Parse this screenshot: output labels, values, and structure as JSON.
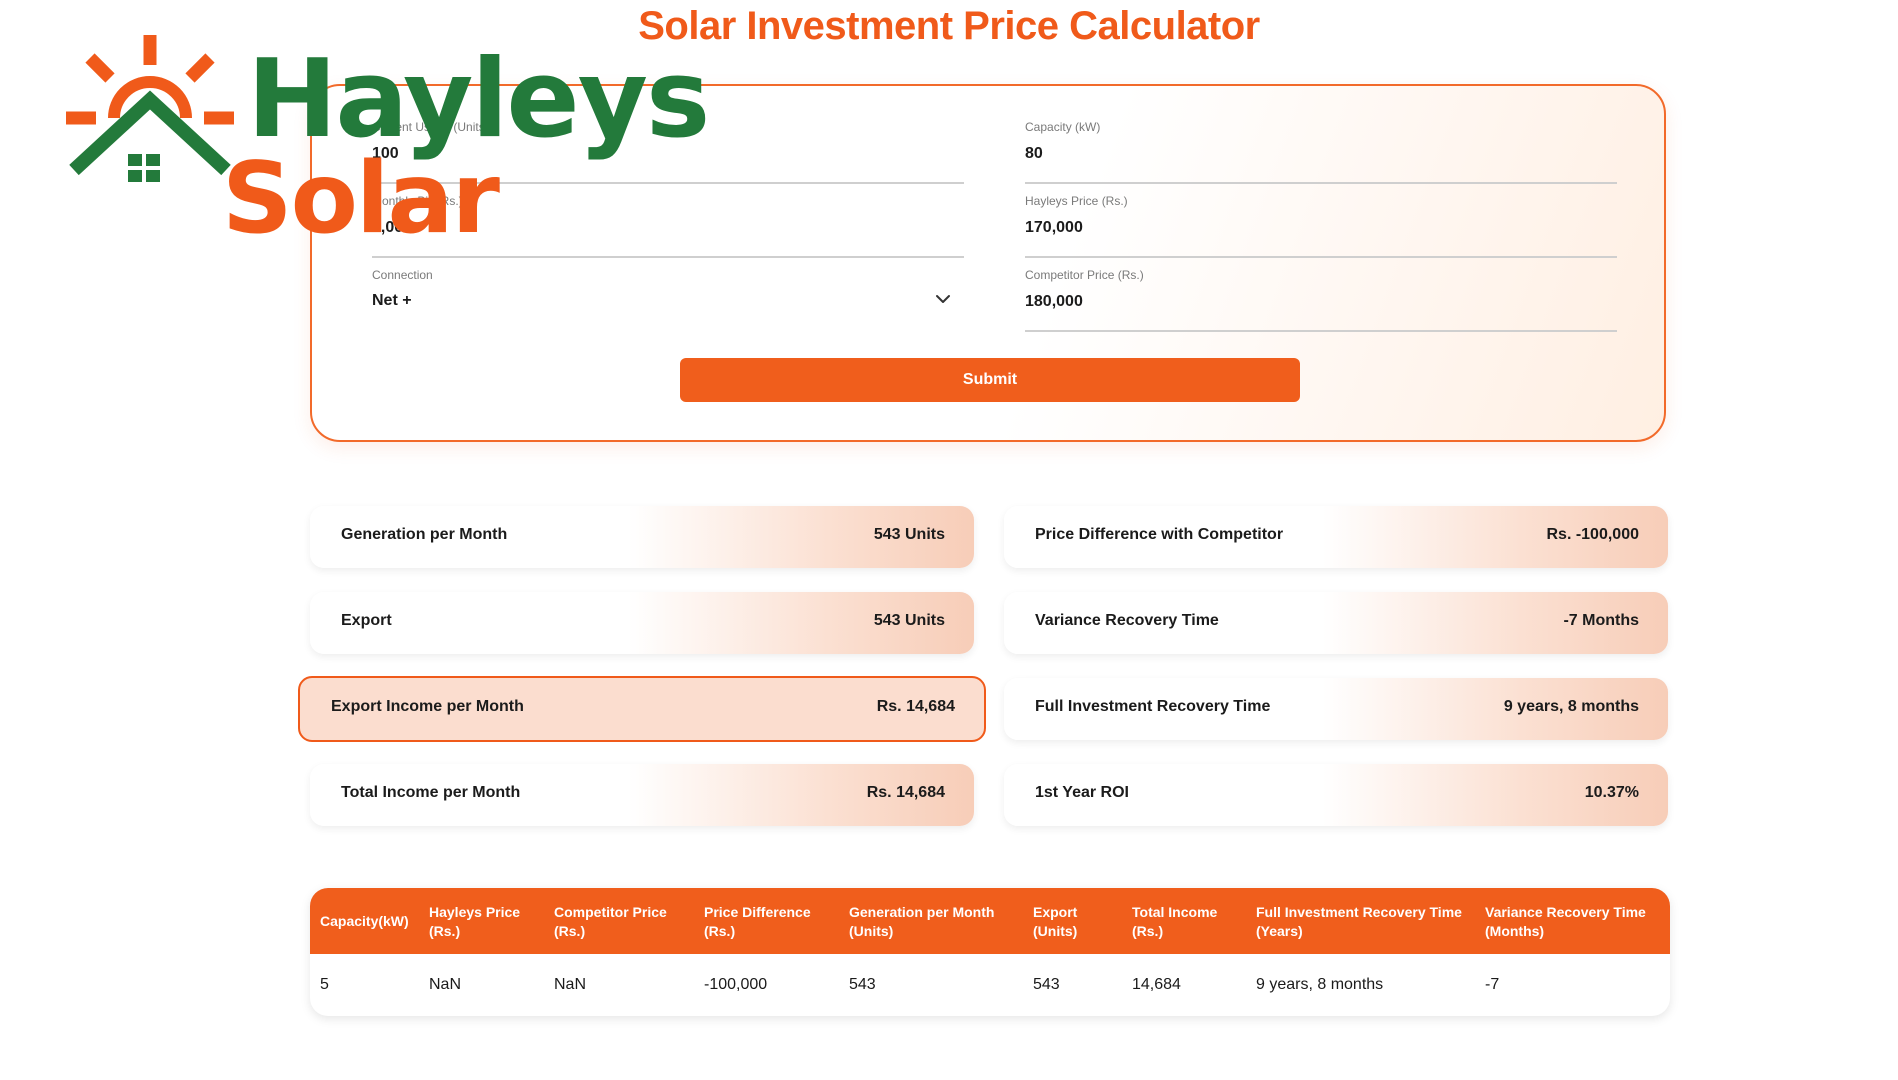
{
  "logo": {
    "top_word": "Hayleys",
    "bottom_word": "Solar"
  },
  "title": "Solar Investment Price Calculator",
  "form": {
    "fields": [
      {
        "label": "Current Usage (Units)",
        "value": "100"
      },
      {
        "label": "Monthly Bill (Rs.)",
        "value": "8,000"
      },
      {
        "label": "Capacity (kW)",
        "value": "80"
      },
      {
        "label": "Hayleys Price (Rs.)",
        "value": "170,000"
      },
      {
        "label": "Competitor Price (Rs.)",
        "value": "180,000"
      }
    ],
    "connection": {
      "label": "Connection",
      "value": "Net +"
    },
    "submit_label": "Submit"
  },
  "results": [
    {
      "label": "Generation per Month",
      "value": "543 Units"
    },
    {
      "label": "Export",
      "value": "543 Units"
    },
    {
      "label": "Export Income per Month",
      "value": "Rs. 14,684"
    },
    {
      "label": "Total Income per Month",
      "value": "Rs. 14,684"
    },
    {
      "label": "Price Difference with Competitor",
      "value": "Rs. -100,000"
    },
    {
      "label": "Variance Recovery Time",
      "value": "-7 Months"
    },
    {
      "label": "Full Investment Recovery Time",
      "value": "9 years, 8 months"
    },
    {
      "label": "1st Year ROI",
      "value": "10.37%"
    }
  ],
  "table": {
    "headers": [
      [
        "Capacity(kW)"
      ],
      [
        "Hayleys Price",
        "(Rs.)"
      ],
      [
        "Competitor Price",
        "(Rs.)"
      ],
      [
        "Price Difference",
        "(Rs.)"
      ],
      [
        "Generation per Month",
        "(Units)"
      ],
      [
        "Export",
        "(Units)"
      ],
      [
        "Total Income",
        "(Rs.)"
      ],
      [
        "Full Investment Recovery Time",
        "(Years)"
      ],
      [
        "Variance Recovery Time",
        "(Months)"
      ]
    ],
    "row": [
      "5",
      "NaN",
      "NaN",
      "-100,000",
      "543",
      "543",
      "14,684",
      "9 years, 8 months",
      "-7"
    ]
  },
  "colors": {
    "accent": "#f05e1c",
    "logo_green": "#237a3b",
    "logo_orange": "#f05a1a"
  }
}
